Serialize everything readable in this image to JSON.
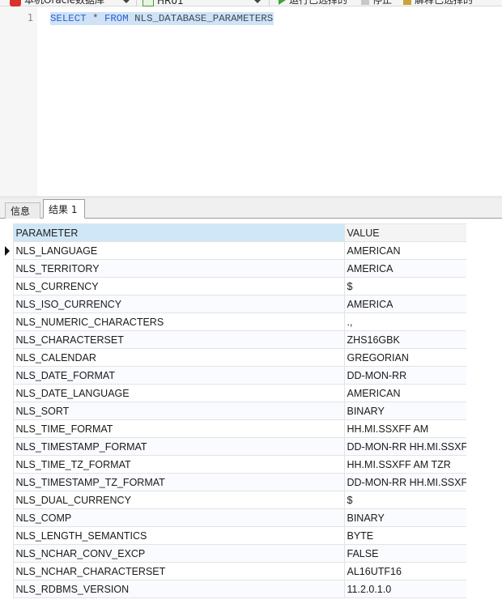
{
  "toolbar": {
    "connection_label": "本机Oracle数据库",
    "database_label": "HR01",
    "run_label": "运行已选择的",
    "stop_label": "停止",
    "explain_label": "解释已选择的"
  },
  "editor": {
    "line_number": "1",
    "sql_select": "SELECT",
    "sql_star": "*",
    "sql_from": "FROM",
    "sql_table": "NLS_DATABASE_PARAMETERS"
  },
  "tabs": {
    "info_label": "信息",
    "result_label": "结果 1"
  },
  "grid": {
    "columns": [
      "PARAMETER",
      "VALUE"
    ],
    "rows": [
      [
        "NLS_LANGUAGE",
        "AMERICAN"
      ],
      [
        "NLS_TERRITORY",
        "AMERICA"
      ],
      [
        "NLS_CURRENCY",
        "$"
      ],
      [
        "NLS_ISO_CURRENCY",
        "AMERICA"
      ],
      [
        "NLS_NUMERIC_CHARACTERS",
        ".,"
      ],
      [
        "NLS_CHARACTERSET",
        "ZHS16GBK"
      ],
      [
        "NLS_CALENDAR",
        "GREGORIAN"
      ],
      [
        "NLS_DATE_FORMAT",
        "DD-MON-RR"
      ],
      [
        "NLS_DATE_LANGUAGE",
        "AMERICAN"
      ],
      [
        "NLS_SORT",
        "BINARY"
      ],
      [
        "NLS_TIME_FORMAT",
        "HH.MI.SSXFF AM"
      ],
      [
        "NLS_TIMESTAMP_FORMAT",
        "DD-MON-RR HH.MI.SSXF"
      ],
      [
        "NLS_TIME_TZ_FORMAT",
        "HH.MI.SSXFF AM TZR"
      ],
      [
        "NLS_TIMESTAMP_TZ_FORMAT",
        "DD-MON-RR HH.MI.SSXF"
      ],
      [
        "NLS_DUAL_CURRENCY",
        "$"
      ],
      [
        "NLS_COMP",
        "BINARY"
      ],
      [
        "NLS_LENGTH_SEMANTICS",
        "BYTE"
      ],
      [
        "NLS_NCHAR_CONV_EXCP",
        "FALSE"
      ],
      [
        "NLS_NCHAR_CHARACTERSET",
        "AL16UTF16"
      ],
      [
        "NLS_RDBMS_VERSION",
        "11.2.0.1.0"
      ]
    ]
  }
}
